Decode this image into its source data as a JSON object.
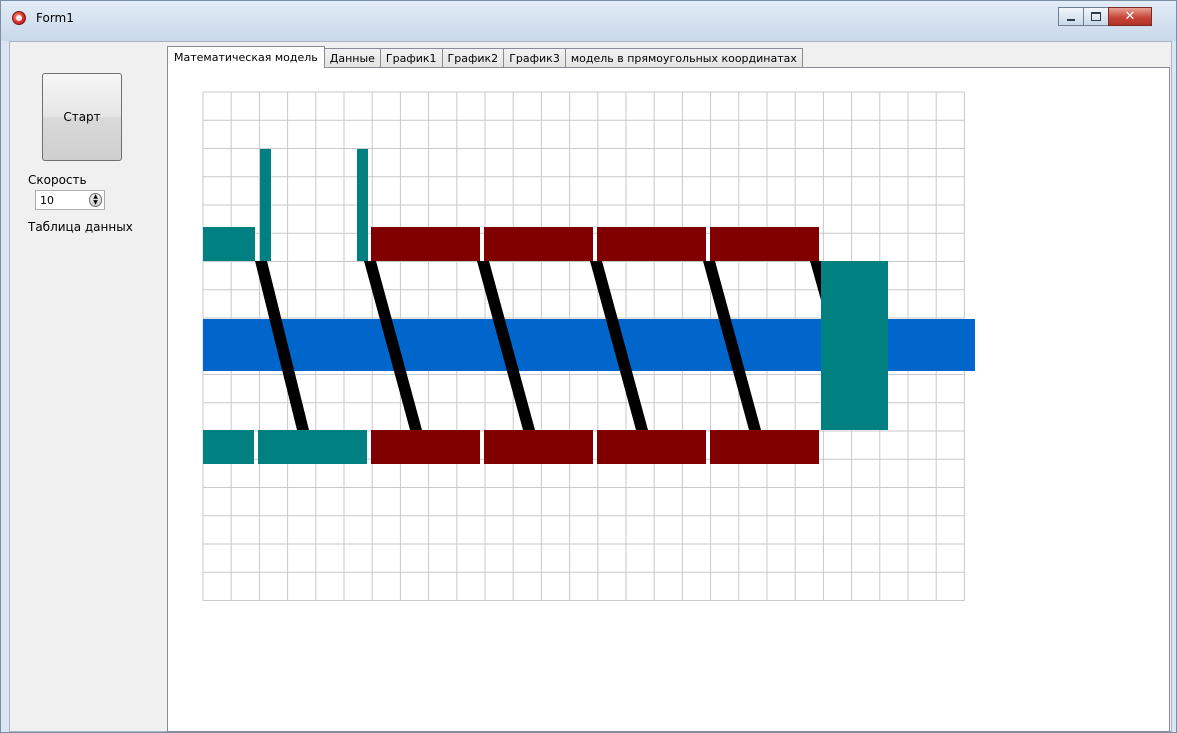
{
  "window": {
    "title": "Form1",
    "controls": {
      "minimize": "minimize",
      "maximize": "maximize",
      "close": "close"
    }
  },
  "left_panel": {
    "start_button": "Старт",
    "speed_label": "Скорость",
    "speed_value": "10",
    "data_table_label": "Таблица данных"
  },
  "tabs": [
    {
      "label": "Математическая модель",
      "active": true
    },
    {
      "label": "Данные",
      "active": false
    },
    {
      "label": "График1",
      "active": false
    },
    {
      "label": "График2",
      "active": false
    },
    {
      "label": "График3",
      "active": false
    },
    {
      "label": "модель в прямоугольных координатах",
      "active": false
    }
  ],
  "model": {
    "grid": {
      "columns": 27,
      "rows": 18
    },
    "colors": {
      "grid": "#c9c9c9",
      "shaft": "#0066cc",
      "barrel_segment": "#800000",
      "feed_block": "#008080",
      "flight": "#000000"
    },
    "icons": [
      "app-icon",
      "spin-updown-icon"
    ]
  }
}
